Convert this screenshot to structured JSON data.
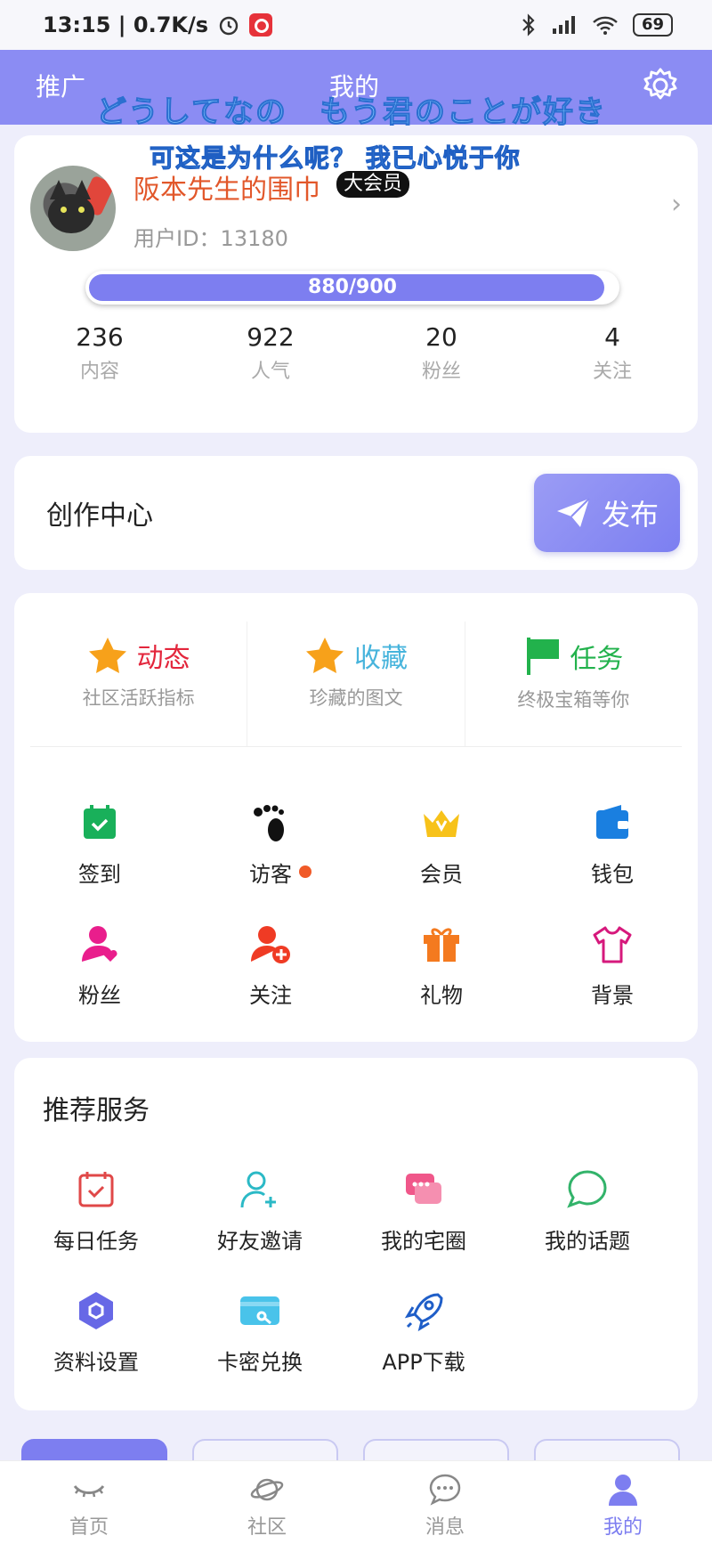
{
  "status_bar": {
    "time_speed": "13:15 | 0.7K/s",
    "battery": "69"
  },
  "header": {
    "left_label": "推广",
    "title": "我的"
  },
  "overlay": {
    "line1": "どうしてなの　もう君のことが好き",
    "line2": "可这是为什么呢？ 我已心悦于你"
  },
  "profile": {
    "username": "阪本先生的围巾",
    "badge": "大会员",
    "user_id": "用户ID：13180",
    "xp_text": "880/900",
    "xp_fraction": 0.978,
    "stats": [
      {
        "value": "236",
        "label": "内容"
      },
      {
        "value": "922",
        "label": "人气"
      },
      {
        "value": "20",
        "label": "粉丝"
      },
      {
        "value": "4",
        "label": "关注"
      }
    ]
  },
  "creation": {
    "title": "创作中心",
    "publish": "发布"
  },
  "top_tiles": [
    {
      "title": "动态",
      "subtitle": "社区活跃指标",
      "color": "#e3263c"
    },
    {
      "title": "收藏",
      "subtitle": "珍藏的图文",
      "color": "#47b4dc"
    },
    {
      "title": "任务",
      "subtitle": "终极宝箱等你",
      "color": "#22b24c"
    }
  ],
  "grid_row1": [
    {
      "label": "签到"
    },
    {
      "label": "访客"
    },
    {
      "label": "会员"
    },
    {
      "label": "钱包"
    }
  ],
  "grid_row2": [
    {
      "label": "粉丝"
    },
    {
      "label": "关注"
    },
    {
      "label": "礼物"
    },
    {
      "label": "背景"
    }
  ],
  "services": {
    "title": "推荐服务",
    "row1": [
      {
        "label": "每日任务"
      },
      {
        "label": "好友邀请"
      },
      {
        "label": "我的宅圈"
      },
      {
        "label": "我的话题"
      }
    ],
    "row2": [
      {
        "label": "资料设置"
      },
      {
        "label": "卡密兑换"
      },
      {
        "label": "APP下载"
      }
    ]
  },
  "bottom_nav": [
    {
      "label": "首页"
    },
    {
      "label": "社区"
    },
    {
      "label": "消息"
    },
    {
      "label": "我的"
    }
  ],
  "colors": {
    "accent": "#7d7ef0",
    "header": "#8b8cf3",
    "username": "#e2572a"
  }
}
